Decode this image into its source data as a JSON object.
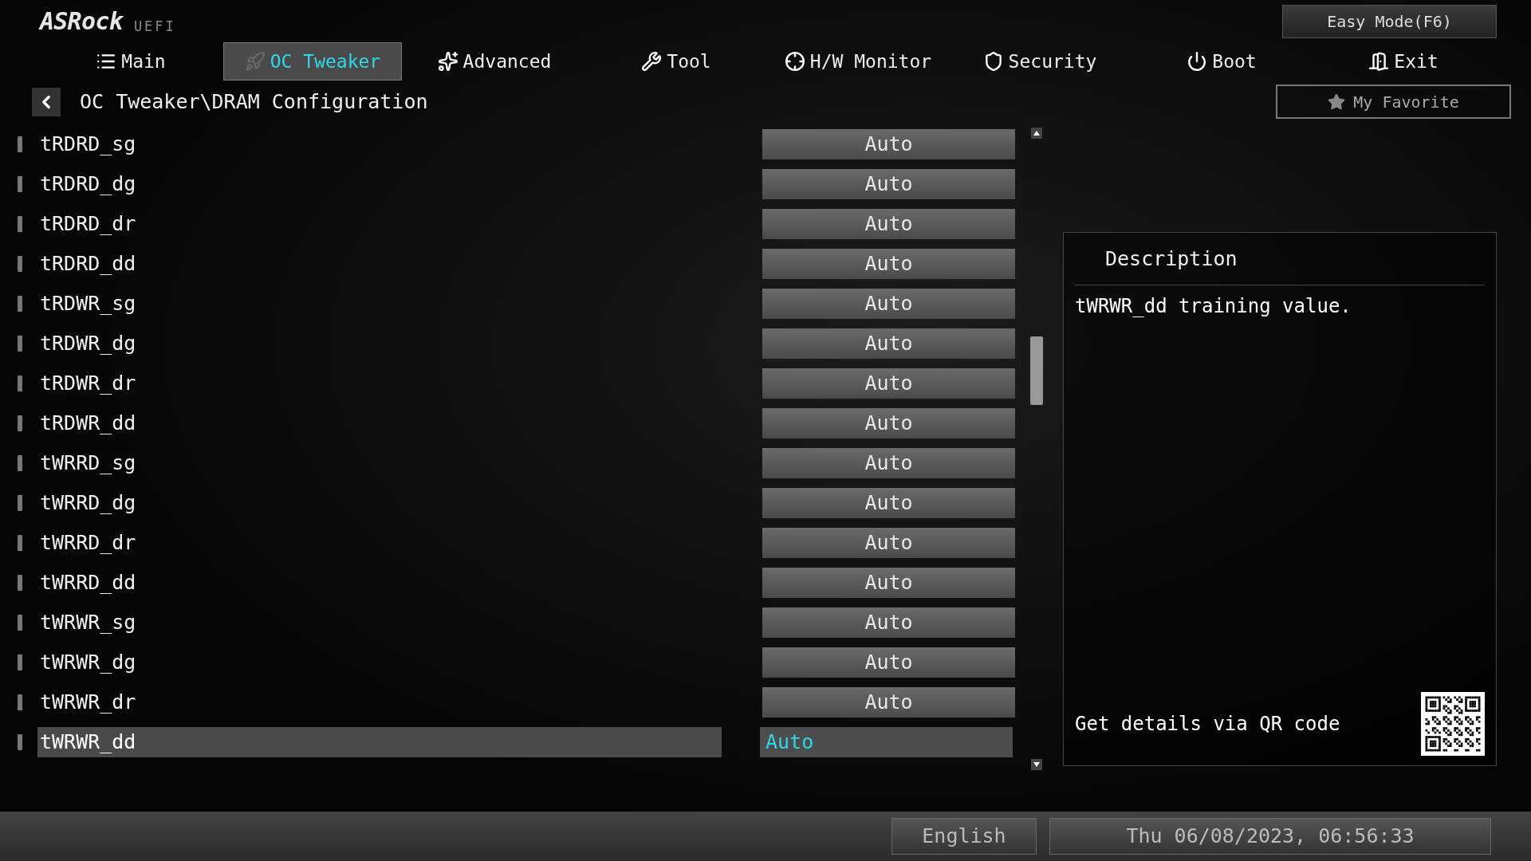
{
  "logo": {
    "brand": "ASRock",
    "product": "UEFI"
  },
  "easy_mode_button": "Easy Mode(F6)",
  "tabs": [
    {
      "label": "Main",
      "selected": false
    },
    {
      "label": "OC Tweaker",
      "selected": true
    },
    {
      "label": "Advanced",
      "selected": false
    },
    {
      "label": "Tool",
      "selected": false
    },
    {
      "label": "H/W Monitor",
      "selected": false
    },
    {
      "label": "Security",
      "selected": false
    },
    {
      "label": "Boot",
      "selected": false
    },
    {
      "label": "Exit",
      "selected": false
    }
  ],
  "breadcrumb": "OC Tweaker\\DRAM Configuration",
  "favorite_button": "My Favorite",
  "settings": [
    {
      "name": "tRDRD_sg",
      "value": "Auto",
      "selected": false
    },
    {
      "name": "tRDRD_dg",
      "value": "Auto",
      "selected": false
    },
    {
      "name": "tRDRD_dr",
      "value": "Auto",
      "selected": false
    },
    {
      "name": "tRDRD_dd",
      "value": "Auto",
      "selected": false
    },
    {
      "name": "tRDWR_sg",
      "value": "Auto",
      "selected": false
    },
    {
      "name": "tRDWR_dg",
      "value": "Auto",
      "selected": false
    },
    {
      "name": "tRDWR_dr",
      "value": "Auto",
      "selected": false
    },
    {
      "name": "tRDWR_dd",
      "value": "Auto",
      "selected": false
    },
    {
      "name": "tWRRD_sg",
      "value": "Auto",
      "selected": false
    },
    {
      "name": "tWRRD_dg",
      "value": "Auto",
      "selected": false
    },
    {
      "name": "tWRRD_dr",
      "value": "Auto",
      "selected": false
    },
    {
      "name": "tWRRD_dd",
      "value": "Auto",
      "selected": false
    },
    {
      "name": "tWRWR_sg",
      "value": "Auto",
      "selected": false
    },
    {
      "name": "tWRWR_dg",
      "value": "Auto",
      "selected": false
    },
    {
      "name": "tWRWR_dr",
      "value": "Auto",
      "selected": false
    },
    {
      "name": "tWRWR_dd",
      "value": "Auto",
      "selected": true
    }
  ],
  "description": {
    "title": "Description",
    "text": "tWRWR_dd training value.",
    "qr_caption": "Get details via QR code"
  },
  "status_bar": {
    "language": "English",
    "datetime": "Thu 06/08/2023, 06:56:33"
  }
}
